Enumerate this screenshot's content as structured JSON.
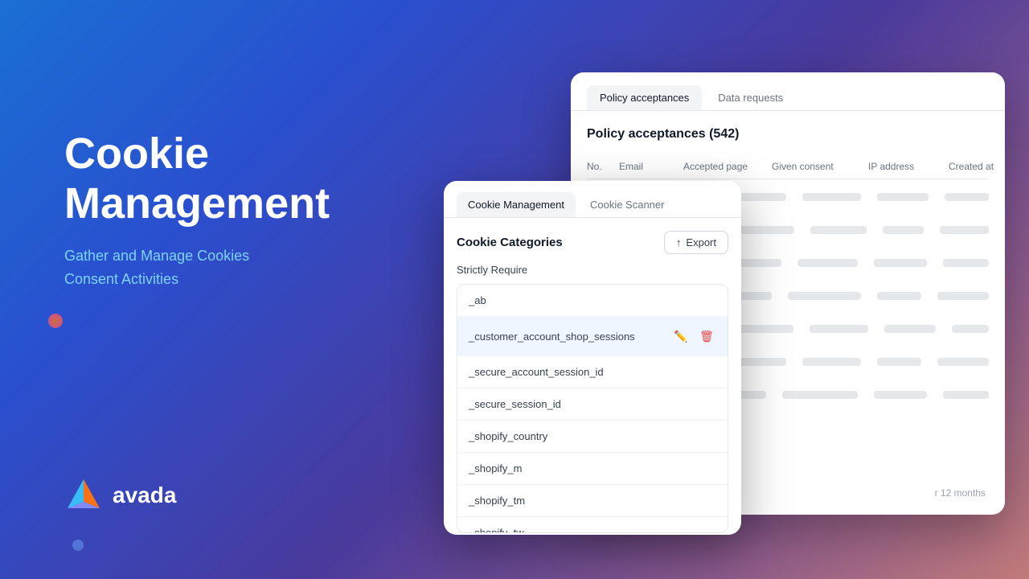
{
  "hero": {
    "title_line1": "Cookie",
    "title_line2": "Management",
    "subtitle_line1": "Gather and Manage Cookies",
    "subtitle_line2": "Consent Activities"
  },
  "logo": {
    "text": "avada"
  },
  "policy_panel": {
    "tab_active": "Policy acceptances",
    "tab_inactive": "Data requests",
    "heading": "Policy acceptances (542)",
    "columns": {
      "no": "No.",
      "email": "Email",
      "accepted_page": "Accepted page",
      "given_consent": "Given consent",
      "ip_address": "IP address",
      "created_at": "Created at"
    },
    "footer_text": "r 12 months"
  },
  "cookie_panel": {
    "tab_active": "Cookie Management",
    "tab_inactive": "Cookie Scanner",
    "categories_title": "Cookie Categories",
    "export_label": "Export",
    "strictly_require_label": "Strictly Require",
    "cookies": [
      {
        "name": "_ab",
        "highlighted": false
      },
      {
        "name": "_customer_account_shop_sessions",
        "highlighted": true
      },
      {
        "name": "_secure_account_session_id",
        "highlighted": false
      },
      {
        "name": "_secure_session_id",
        "highlighted": false
      },
      {
        "name": "_shopify_country",
        "highlighted": false
      },
      {
        "name": "_shopify_m",
        "highlighted": false
      },
      {
        "name": "_shopify_tm",
        "highlighted": false
      },
      {
        "name": "_shopify_tw",
        "highlighted": false
      }
    ]
  }
}
